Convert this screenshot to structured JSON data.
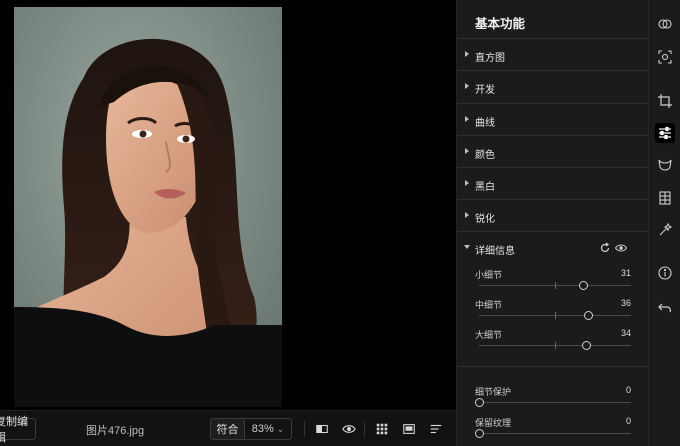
{
  "image": {
    "filename": "图片476.jpg"
  },
  "bottombar": {
    "copy_edit_label": "复制编辑",
    "fit_label": "符合",
    "zoom_value": "83%",
    "zoom_chevron": "⌄"
  },
  "panel": {
    "title": "基本功能",
    "sections": [
      {
        "label": "直方图",
        "expanded": false
      },
      {
        "label": "开发",
        "expanded": false
      },
      {
        "label": "曲线",
        "expanded": false
      },
      {
        "label": "颜色",
        "expanded": false
      },
      {
        "label": "黑白",
        "expanded": false
      },
      {
        "label": "锐化",
        "expanded": false
      },
      {
        "label": "详细信息",
        "expanded": true
      }
    ],
    "sliders": [
      {
        "label": "小细节",
        "value": "31",
        "level": 0.69
      },
      {
        "label": "中细节",
        "value": "36",
        "level": 0.72
      },
      {
        "label": "大细节",
        "value": "34",
        "level": 0.71
      },
      {
        "label": "细节保护",
        "value": "0",
        "level": 0.0
      },
      {
        "label": "保留纹理",
        "value": "0",
        "level": 0.0
      }
    ]
  },
  "colors": {
    "panel_bg": "#1b1b1b",
    "canvas_bg": "#000000",
    "text": "#e6e6e6",
    "slider_thumb": "#cfcfcf"
  },
  "icons": {
    "strip": [
      "layers-icon",
      "focus-icon",
      "crop-icon",
      "adjust-sliders-icon",
      "mask-icon",
      "texture-icon",
      "magic-wand-icon",
      "info-icon",
      "undo-icon"
    ],
    "bottombar": [
      "compare-icon",
      "eye-icon",
      "grid-view-icon",
      "single-view-icon",
      "sort-icon"
    ],
    "detail_tools": [
      "reset-icon",
      "visibility-icon"
    ]
  }
}
